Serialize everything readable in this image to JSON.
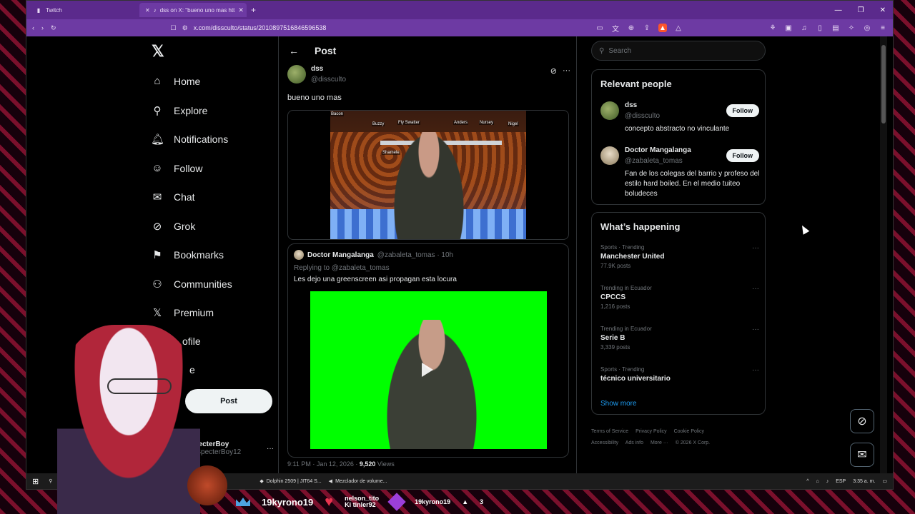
{
  "browser": {
    "tabs": [
      {
        "label": "Twitch",
        "icon": "twitch-icon"
      },
      {
        "label": "dss on X: \"bueno uno mas htt",
        "icon": "x-icon"
      }
    ],
    "url": "x.com/dissculto/status/2010897516846596538"
  },
  "leftnav": {
    "items": [
      {
        "label": "Home",
        "icon": "home-icon"
      },
      {
        "label": "Explore",
        "icon": "search-icon"
      },
      {
        "label": "Notifications",
        "icon": "bell-icon"
      },
      {
        "label": "Follow",
        "icon": "add-person-icon"
      },
      {
        "label": "Chat",
        "icon": "mail-icon"
      },
      {
        "label": "Grok",
        "icon": "grok-icon"
      },
      {
        "label": "Bookmarks",
        "icon": "bookmark-icon"
      },
      {
        "label": "Communities",
        "icon": "people-icon"
      },
      {
        "label": "Premium",
        "icon": "x-icon"
      },
      {
        "label": "ofile",
        "icon": ""
      },
      {
        "label": "e",
        "icon": ""
      }
    ],
    "post_button": "Post",
    "account": {
      "name": "TheSpecterBoy",
      "handle": "@TheSpecterBoy12"
    }
  },
  "main": {
    "header": "Post",
    "tweet": {
      "name": "dss",
      "handle": "@dissculto",
      "text": "bueno uno mas",
      "game_labels": [
        "Bacon",
        "Buzzy",
        "Fly Swatter",
        "Anders",
        "Nursey",
        "Nigel",
        "Shamele"
      ],
      "meta_time": "9:11 PM · Jan 12, 2026 · ",
      "meta_views": "9,520",
      "meta_views_label": " Views"
    },
    "quote": {
      "name": "Doctor Mangalanga",
      "handle": "@zabaleta_tomas · 10h",
      "reply_prefix": "Replying to ",
      "reply_handle": "@zabaleta_tomas",
      "text": "Les dejo una greenscreen asi propagan esta locura"
    }
  },
  "right": {
    "search_placeholder": "Search",
    "relevant_title": "Relevant people",
    "people": [
      {
        "name": "dss",
        "handle": "@dissculto",
        "bio": "concepto abstracto no vinculante",
        "button": "Follow"
      },
      {
        "name": "Doctor Mangalanga",
        "handle": "@zabaleta_tomas",
        "bio": "Fan de los colegas del barrio y profeso del estilo hard boiled. En el medio tuiteo boludeces",
        "button": "Follow"
      }
    ],
    "happening_title": "What’s happening",
    "trends": [
      {
        "category": "Sports · Trending",
        "name": "Manchester United",
        "count": "77.9K posts"
      },
      {
        "category": "Trending in Ecuador",
        "name": "CPCCS",
        "count": "1,216 posts"
      },
      {
        "category": "Trending in Ecuador",
        "name": "Serie B",
        "count": "3,339 posts"
      },
      {
        "category": "Sports · Trending",
        "name": "técnico universitario",
        "count": ""
      }
    ],
    "show_more": "Show more",
    "footer": [
      "Terms of Service",
      "Privacy Policy",
      "Cookie Policy",
      "Accessibility",
      "Ads info",
      "More ···",
      "© 2026 X Corp."
    ]
  },
  "taskbar": {
    "tasks": [
      "Dolphin 2509 | JIT64 S...",
      "Mezclador de volume..."
    ],
    "lang": "ESP",
    "time": "3:35 a. m."
  },
  "overlay": {
    "user1": "19kyrono19",
    "user2_line1": "nelson_tito",
    "user2_line2": "Ki tinler92",
    "user3": "19kyrono19",
    "user3_count": "3"
  }
}
